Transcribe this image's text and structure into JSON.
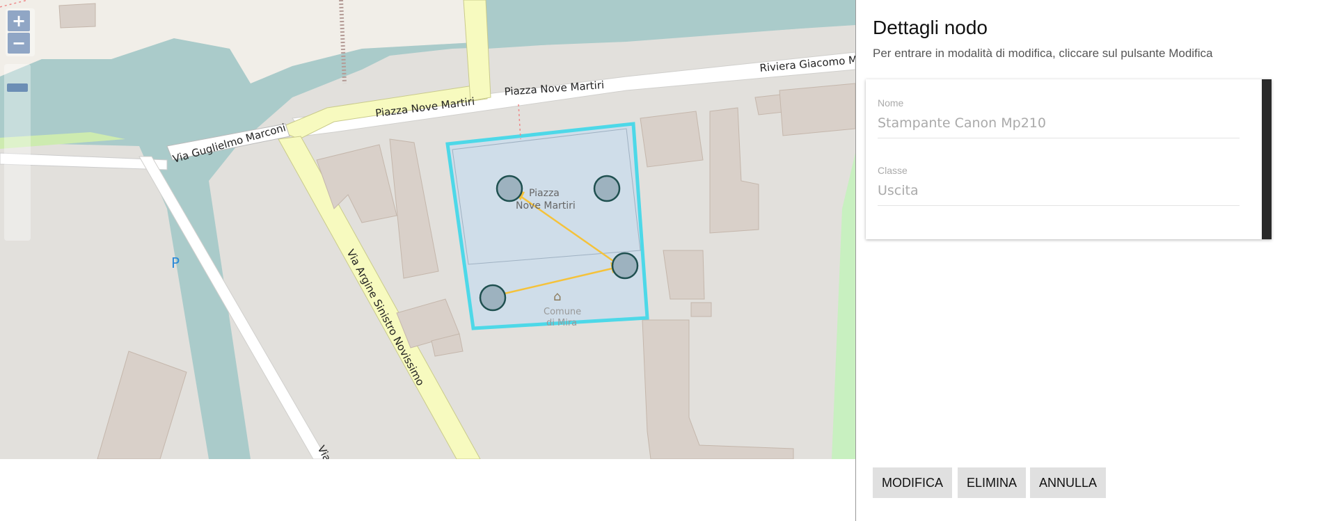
{
  "map": {
    "streets": {
      "piazza_nove_martiri_1": "Piazza Nove Martiri",
      "piazza_nove_martiri_2": "Piazza Nove Martiri",
      "riviera": "Riviera Giacomo Ma",
      "via_marconi": "Via Guglielmo Marconi",
      "via_argine": "Via Argine Sinistro Novissimo",
      "via_cut": "Via"
    },
    "place_label_line1": "Piazza",
    "place_label_line2": "Nove Martiri",
    "poi_label_line1": "Comune",
    "poi_label_line2": "di Mira",
    "parking_label": "P",
    "zoom_in": "+",
    "zoom_out": "−",
    "colors": {
      "water": "#aacbca",
      "primary_road": "#f7fabf",
      "building": "#d9d0c9",
      "land": "#e2e0dc",
      "selection": "#4dd8e8",
      "flow_arrow": "#f5c23a"
    }
  },
  "panel": {
    "title": "Dettagli nodo",
    "subtitle": "Per entrare in modalità di modifica, cliccare sul pulsante Modifica",
    "fields": [
      {
        "label": "Nome",
        "value": "Stampante Canon Mp210"
      },
      {
        "label": "Classe",
        "value": "Uscita"
      }
    ],
    "buttons": {
      "modifica": "MODIFICA",
      "elimina": "ELIMINA",
      "annulla": "ANNULLA"
    }
  },
  "stray_text": ";"
}
